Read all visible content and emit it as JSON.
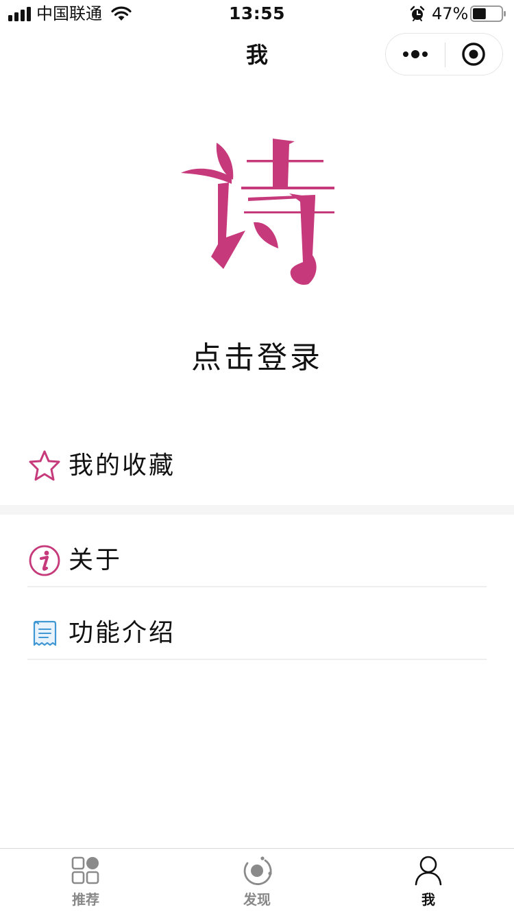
{
  "status_bar": {
    "carrier": "中国联通",
    "time": "13:55",
    "battery_percent": "47%",
    "battery_level": 0.47
  },
  "nav": {
    "title": "我"
  },
  "profile": {
    "logo_char": "诗",
    "logo_color": "#c6397a",
    "login_label": "点击登录"
  },
  "menu": {
    "favorites_label": "我的收藏",
    "about_label": "关于",
    "intro_label": "功能介绍"
  },
  "tabs": [
    {
      "label": "推荐",
      "icon": "grid-icon",
      "active": false
    },
    {
      "label": "发现",
      "icon": "discover-icon",
      "active": false
    },
    {
      "label": "我",
      "icon": "person-icon",
      "active": true
    }
  ]
}
